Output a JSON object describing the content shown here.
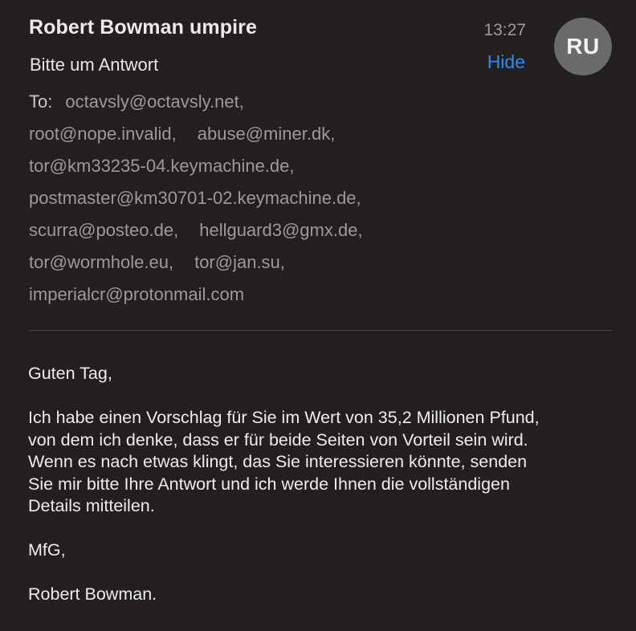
{
  "header": {
    "sender": "Robert Bowman umpire",
    "subject": "Bitte um Antwort",
    "time": "13:27",
    "hide_label": "Hide",
    "avatar_initials": "RU"
  },
  "recipients": {
    "to_label": "To:",
    "lines": [
      [
        "octavsly@octavsly.net,"
      ],
      [
        "root@nope.invalid,",
        "abuse@miner.dk,"
      ],
      [
        "tor@km33235-04.keymachine.de,"
      ],
      [
        "postmaster@km30701-02.keymachine.de,"
      ],
      [
        "scurra@posteo.de,",
        "hellguard3@gmx.de,"
      ],
      [
        "tor@wormhole.eu,",
        "tor@jan.su,"
      ],
      [
        "imperialcr@protonmail.com"
      ]
    ]
  },
  "body": {
    "greeting": "Guten Tag,",
    "paragraph": [
      "Ich habe einen Vorschlag für Sie im Wert von 35,2 Millionen Pfund,",
      "von dem ich denke, dass er für beide Seiten von Vorteil sein wird.",
      "Wenn es nach etwas klingt, das Sie interessieren könnte, senden",
      "Sie mir bitte Ihre Antwort und ich werde Ihnen die vollständigen",
      "Details mitteilen."
    ],
    "closing": "MfG,",
    "signature": "Robert Bowman."
  },
  "colors": {
    "background": "#231f1f",
    "accent_link": "#2e8cf0",
    "avatar": "#6a6a6c"
  }
}
